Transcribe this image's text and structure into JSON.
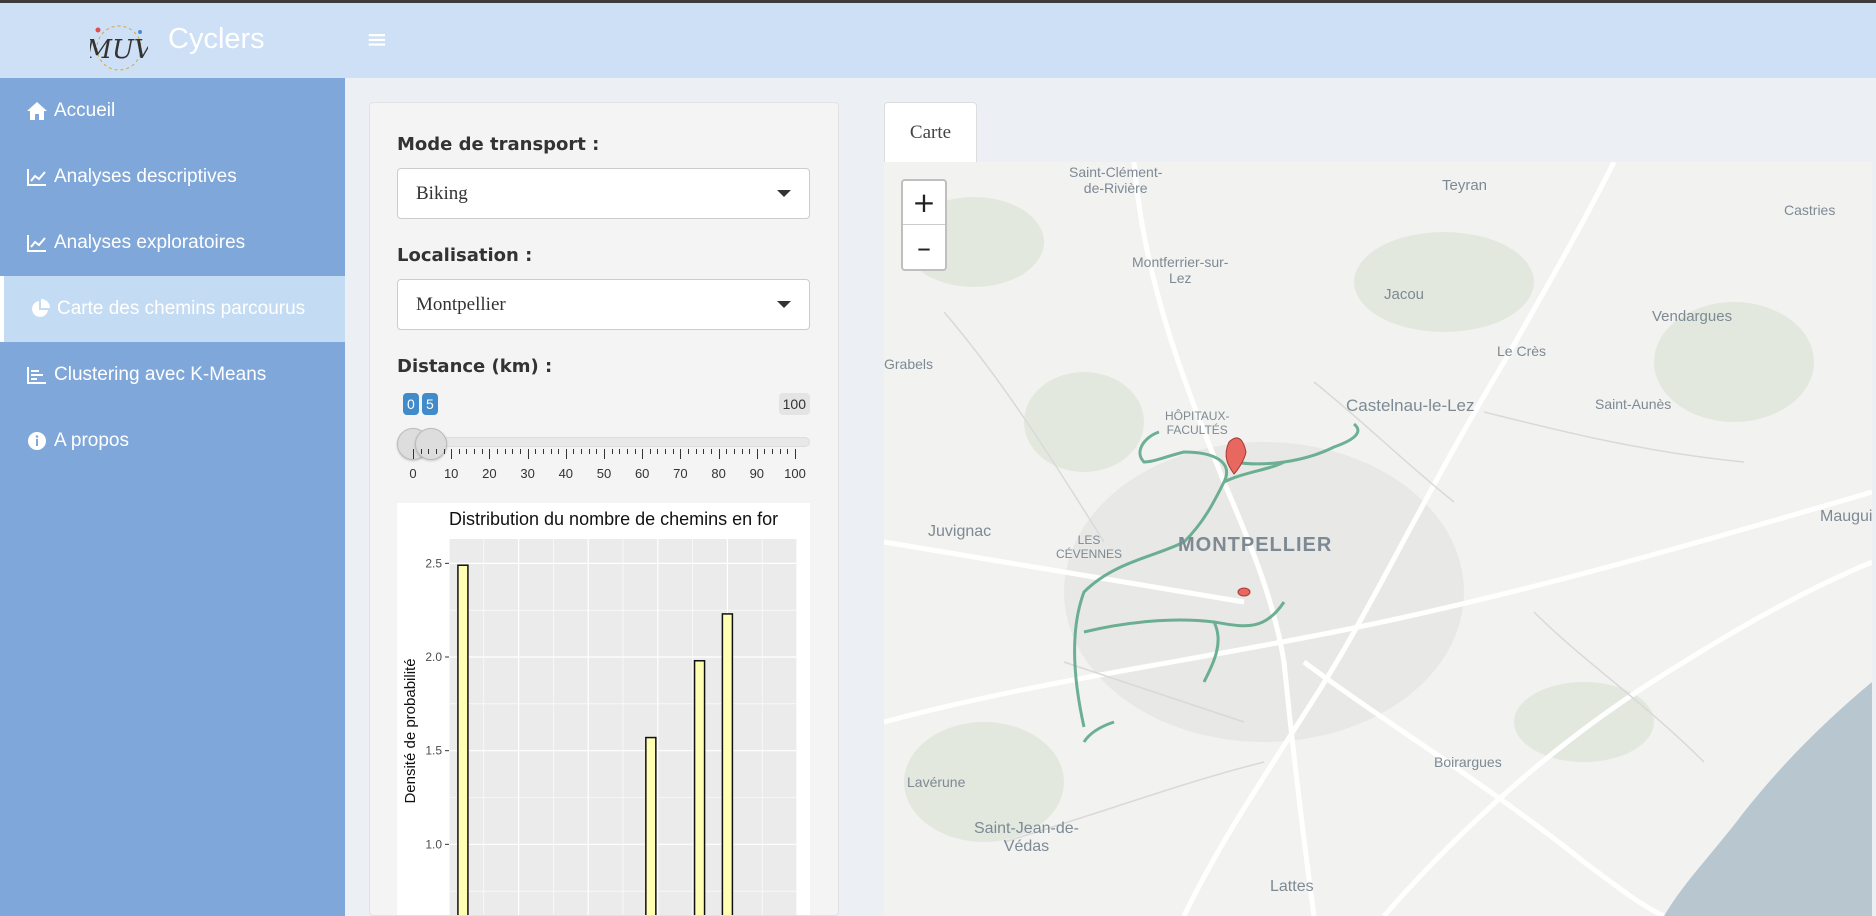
{
  "header": {
    "app_title": "Cyclers",
    "logo_text": "MUV",
    "menu_icon": "hamburger-icon"
  },
  "sidebar": {
    "items": [
      {
        "label": "Accueil",
        "icon": "home-icon",
        "active": false
      },
      {
        "label": "Analyses descriptives",
        "icon": "line-chart-icon",
        "active": false
      },
      {
        "label": "Analyses exploratoires",
        "icon": "line-chart-icon",
        "active": false
      },
      {
        "label": "Carte des chemins parcourus",
        "icon": "pie-chart-icon",
        "active": true
      },
      {
        "label": "Clustering avec K-Means",
        "icon": "bar-chart-icon",
        "active": false
      },
      {
        "label": "A propos",
        "icon": "info-circle-icon",
        "active": false
      }
    ]
  },
  "controls": {
    "transport": {
      "label": "Mode de transport :",
      "value": "Biking"
    },
    "location": {
      "label": "Localisation :",
      "value": "Montpellier"
    },
    "distance": {
      "label": "Distance (km) :",
      "from": "0",
      "to": "5",
      "max_label": "100",
      "min": 0,
      "max": 100,
      "ticks": [
        "0",
        "10",
        "20",
        "30",
        "40",
        "50",
        "60",
        "70",
        "80",
        "90",
        "100"
      ]
    }
  },
  "chart_data": {
    "type": "bar",
    "title": "Distribution du nombre de chemins en for",
    "ylabel": "Densité de probabilité",
    "ylim": [
      0.58,
      2.63
    ],
    "yticks": [
      1.0,
      1.5,
      2.0,
      2.5
    ],
    "ytick_labels": [
      "1.0",
      "1.5",
      "2.0",
      "2.5"
    ],
    "x_domain": [
      0,
      5
    ],
    "x": [
      0.2,
      2.9,
      3.6,
      4.0
    ],
    "values": [
      2.49,
      1.57,
      1.98,
      2.23
    ],
    "bar_color": "#ffffb3",
    "grid": true
  },
  "map_tab": {
    "tab_label": "Carte",
    "zoom_in": "+",
    "zoom_out": "–",
    "places": [
      {
        "name": "Saint-Clément-\nde-Rivière",
        "major": false
      },
      {
        "name": "Teyran",
        "major": false
      },
      {
        "name": "Castries",
        "major": false
      },
      {
        "name": "Montferrier-sur-\nLez",
        "major": false
      },
      {
        "name": "Jacou",
        "major": false
      },
      {
        "name": "Vendargues",
        "major": false
      },
      {
        "name": "Le Crès",
        "major": false
      },
      {
        "name": "Grabels",
        "major": false
      },
      {
        "name": "HÔPITAUX-\nFACULTÉS",
        "major": false
      },
      {
        "name": "Castelnau-le-Lez",
        "major": false
      },
      {
        "name": "Saint-Aunès",
        "major": false
      },
      {
        "name": "Juvignac",
        "major": false
      },
      {
        "name": "LES\nCÉVENNES",
        "major": false
      },
      {
        "name": "MONTPELLIER",
        "major": true
      },
      {
        "name": "Mauguio",
        "major": false
      },
      {
        "name": "Boirargues",
        "major": false
      },
      {
        "name": "Lavérune",
        "major": false
      },
      {
        "name": "Saint-Jean-de-\nVédas",
        "major": false
      },
      {
        "name": "Lattes",
        "major": false
      }
    ],
    "path_color": "#5fa88a",
    "marker_color": "#e8675e"
  }
}
